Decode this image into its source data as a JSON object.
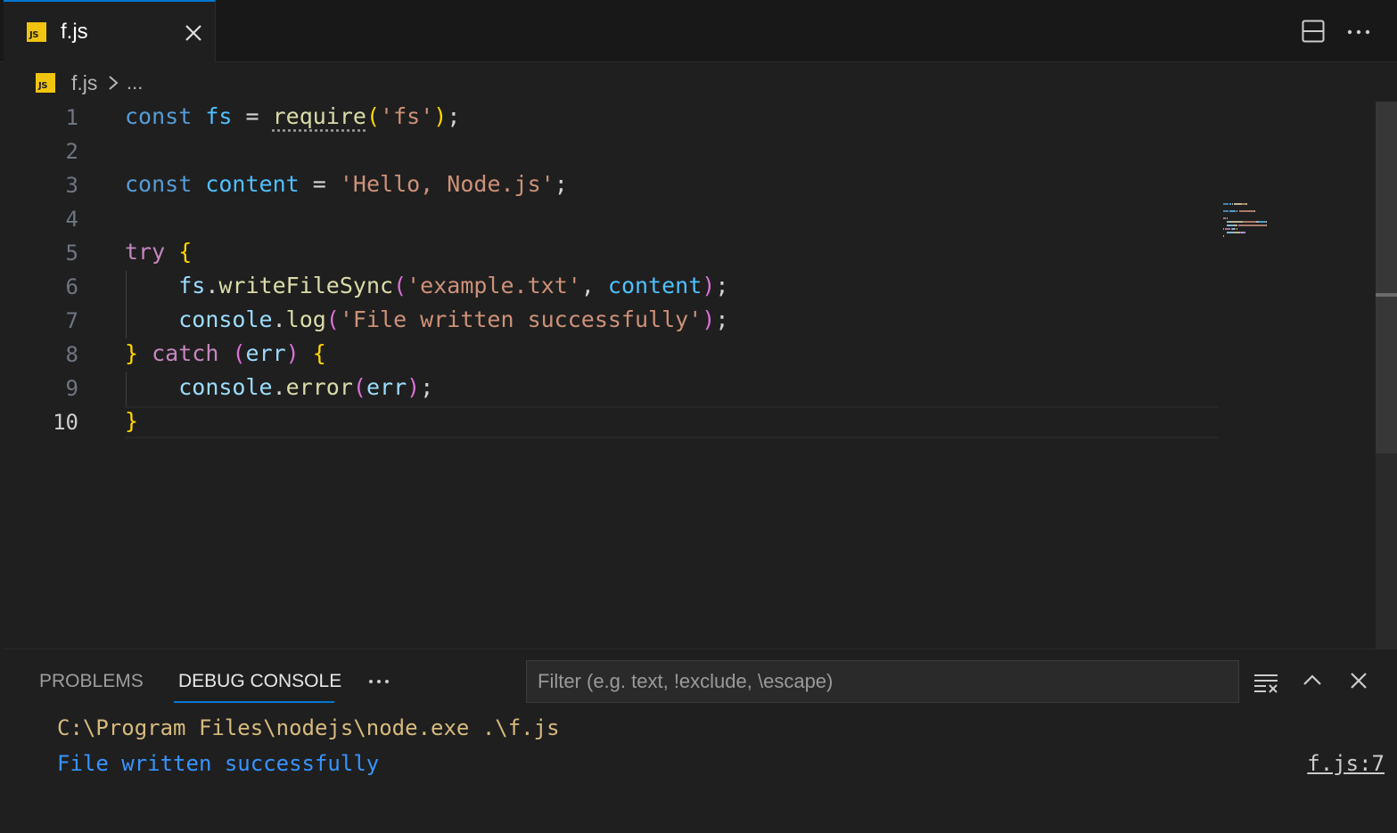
{
  "tab": {
    "icon": "JS",
    "label": "f.js",
    "close_icon": "close-icon"
  },
  "toolbar": {
    "split_icon": "split-editor-icon",
    "more_icon": "more-actions-icon"
  },
  "breadcrumb": {
    "icon": "JS",
    "file": "f.js",
    "separator_icon": "chevron-right-icon",
    "more": "..."
  },
  "editor": {
    "active_line": 10,
    "line_numbers": [
      "1",
      "2",
      "3",
      "4",
      "5",
      "6",
      "7",
      "8",
      "9",
      "10"
    ]
  },
  "panel": {
    "tabs": [
      "PROBLEMS",
      "DEBUG CONSOLE"
    ],
    "active_tab": "DEBUG CONSOLE",
    "more": "···",
    "filter_placeholder": "Filter (e.g. text, !exclude, \\escape)",
    "filter_value": "",
    "icons": [
      "clear-console-icon",
      "maximize-panel-icon",
      "close-panel-icon"
    ],
    "console_lines": [
      "C:\\Program Files\\nodejs\\node.exe .\\f.js",
      "File written successfully"
    ],
    "console_source": "f.js:7"
  },
  "colors": {
    "accent": "#0078d4",
    "console_command": "#d7ba7d",
    "console_output": "#3794ff",
    "js_badge": "#f1c40f"
  }
}
